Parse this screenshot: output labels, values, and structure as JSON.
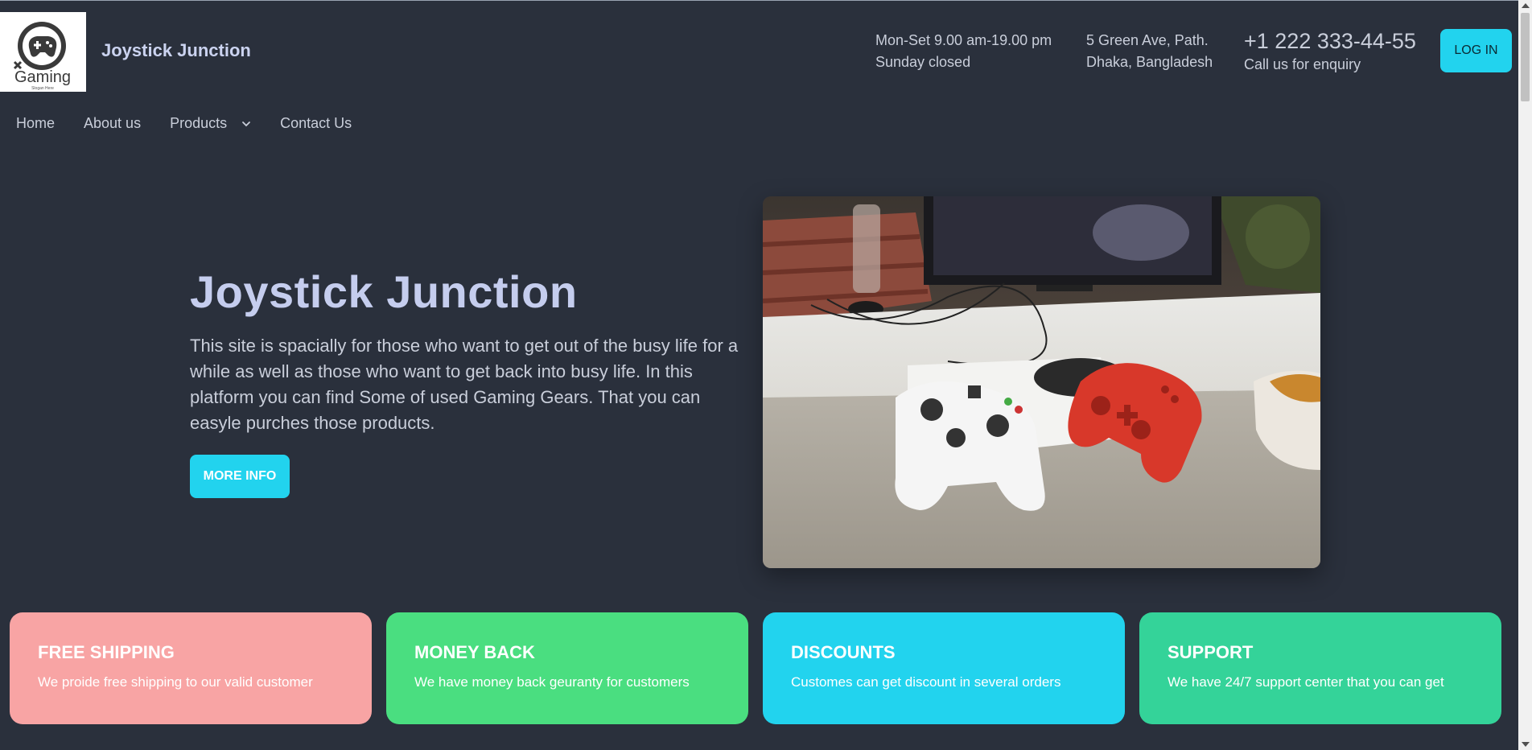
{
  "header": {
    "brand": "Joystick Junction",
    "logo_text": "Gaming",
    "logo_slogan": "Slogan Here",
    "hours_line1": "Mon-Set 9.00 am-19.00 pm",
    "hours_line2": "Sunday closed",
    "address_line1": "5 Green Ave, Path.",
    "address_line2": "Dhaka, Bangladesh",
    "phone": "+1 222 333-44-55",
    "enquiry": "Call us for enquiry",
    "login_label": "LOG IN"
  },
  "nav": {
    "items": [
      {
        "label": "Home"
      },
      {
        "label": "About us"
      },
      {
        "label": "Products"
      },
      {
        "label": "Contact Us"
      }
    ]
  },
  "hero": {
    "title": "Joystick Junction",
    "text": "This site is spacially for those who want to get out of the busy life for a while as well as those who want to get back into busy life. In this platform you can find Some of used Gaming Gears. That you can easyle purches those products.",
    "button_label": "MORE INFO"
  },
  "features": [
    {
      "title": "FREE SHIPPING",
      "text": "We proide free shipping to our valid customer",
      "color": "#f8a4a4"
    },
    {
      "title": "MONEY BACK",
      "text": "We have money back geuranty for customers",
      "color": "#4ade80"
    },
    {
      "title": "DISCOUNTS",
      "text": "Customes can get discount in several orders",
      "color": "#22d3ee"
    },
    {
      "title": "SUPPORT",
      "text": "We have 24/7 support center that you can get",
      "color": "#34d399"
    }
  ],
  "colors": {
    "background": "#2a303c",
    "accent": "#22d3ee"
  },
  "icons": {
    "logo": "gamepad-logo-icon",
    "nav_dropdown": "chevron-down-icon",
    "hero_image": "game-controllers-photo"
  }
}
